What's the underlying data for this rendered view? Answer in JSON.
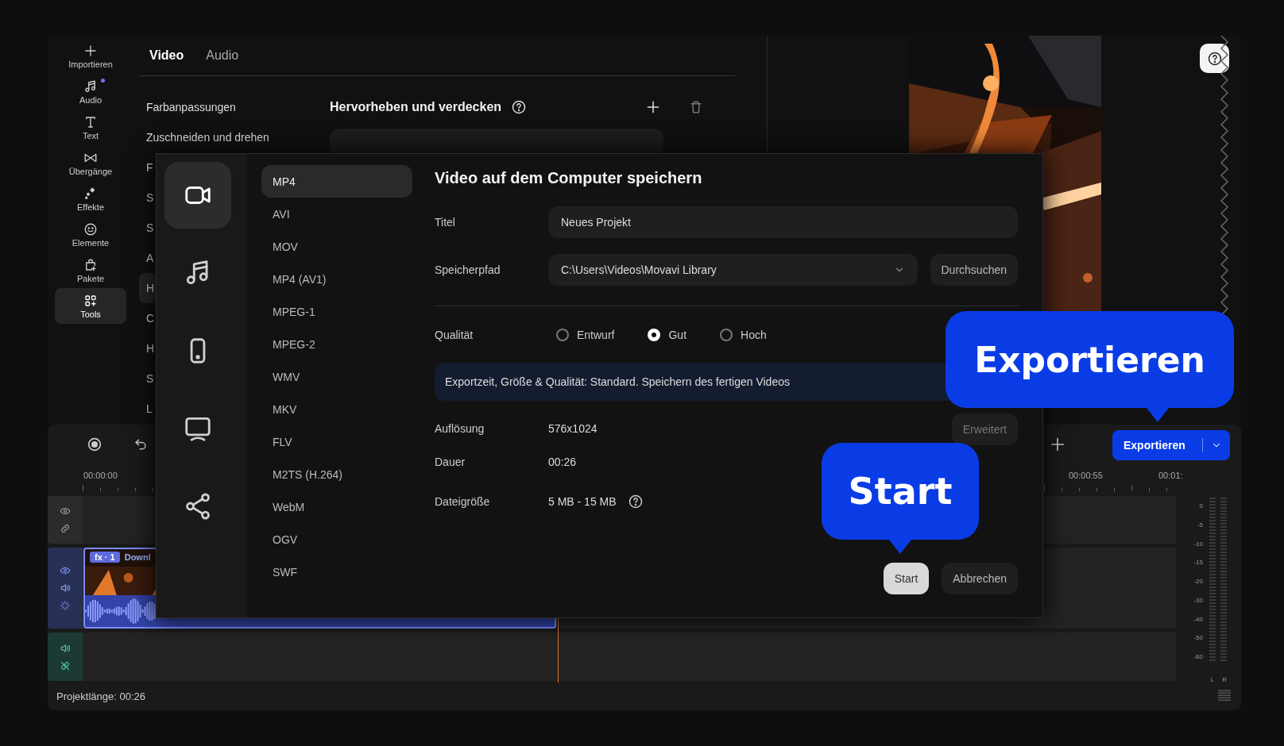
{
  "sidebar": {
    "items": [
      {
        "kind": "plus",
        "label": "Importieren",
        "selected": false,
        "badge": false
      },
      {
        "kind": "music",
        "label": "Audio",
        "selected": false,
        "badge": true
      },
      {
        "kind": "text",
        "label": "Text",
        "selected": false,
        "badge": false
      },
      {
        "kind": "transition",
        "label": "Übergänge",
        "selected": false,
        "badge": false
      },
      {
        "kind": "effects",
        "label": "Effekte",
        "selected": false,
        "badge": false
      },
      {
        "kind": "emoji",
        "label": "Elemente",
        "selected": false,
        "badge": false
      },
      {
        "kind": "package",
        "label": "Pakete",
        "selected": false,
        "badge": false
      },
      {
        "kind": "tools",
        "label": "Tools",
        "selected": true,
        "badge": false
      }
    ]
  },
  "panel": {
    "tabs": [
      {
        "label": "Video",
        "selected": true
      },
      {
        "label": "Audio",
        "selected": false
      }
    ],
    "items": [
      {
        "label": "Farbanpassungen",
        "selected": false
      },
      {
        "label": "Zuschneiden und drehen",
        "selected": false
      },
      {
        "label": "F",
        "selected": false
      },
      {
        "label": "S",
        "selected": false
      },
      {
        "label": "S",
        "selected": false
      },
      {
        "label": "A",
        "selected": false
      },
      {
        "label": "H",
        "selected": true
      },
      {
        "label": "C",
        "selected": false
      },
      {
        "label": "H",
        "selected": false
      },
      {
        "label": "S",
        "selected": false
      },
      {
        "label": "L",
        "selected": false
      }
    ],
    "section_title": "Hervorheben und verdecken"
  },
  "timeline": {
    "timecodes": [
      "00:00:00",
      "00:00:55",
      "00:01:"
    ],
    "export_button": "Exportieren",
    "tracks": [
      {
        "kind": "overlay"
      },
      {
        "kind": "video"
      },
      {
        "kind": "audio"
      }
    ],
    "clip": {
      "badge": "fx · 1",
      "name": "Downl"
    },
    "meter_scale": [
      "0",
      "-5",
      "-10",
      "-15",
      "-20",
      "-30",
      "-40",
      "-50",
      "-60"
    ],
    "meter_channels": [
      "L",
      "R"
    ],
    "project_length": "Projektlänge: 00:26"
  },
  "dialog": {
    "categories": [
      {
        "kind": "video",
        "selected": true
      },
      {
        "kind": "audio",
        "selected": false
      },
      {
        "kind": "mobile",
        "selected": false
      },
      {
        "kind": "tv",
        "selected": false
      },
      {
        "kind": "share",
        "selected": false
      }
    ],
    "formats": [
      {
        "label": "MP4",
        "selected": true
      },
      {
        "label": "AVI",
        "selected": false
      },
      {
        "label": "MOV",
        "selected": false
      },
      {
        "label": "MP4 (AV1)",
        "selected": false
      },
      {
        "label": "MPEG-1",
        "selected": false
      },
      {
        "label": "MPEG-2",
        "selected": false
      },
      {
        "label": "WMV",
        "selected": false
      },
      {
        "label": "MKV",
        "selected": false
      },
      {
        "label": "FLV",
        "selected": false
      },
      {
        "label": "M2TS (H.264)",
        "selected": false
      },
      {
        "label": "WebM",
        "selected": false
      },
      {
        "label": "OGV",
        "selected": false
      },
      {
        "label": "SWF",
        "selected": false
      }
    ],
    "title": "Video auf dem Computer speichern",
    "title_label": "Titel",
    "title_value": "Neues Projekt",
    "path_label": "Speicherpfad",
    "path_value": "C:\\Users\\Videos\\Movavi Library",
    "browse_button": "Durchsuchen",
    "quality_label": "Qualität",
    "quality_options": [
      {
        "label": "Entwurf",
        "selected": false
      },
      {
        "label": "Gut",
        "selected": true
      },
      {
        "label": "Hoch",
        "selected": false
      }
    ],
    "info": "Exportzeit, Größe & Qualität: Standard. Speichern des fertigen Videos",
    "details": [
      {
        "label": "Auflösung",
        "value": "576x1024",
        "help": false
      },
      {
        "label": "Dauer",
        "value": "00:26",
        "help": false
      },
      {
        "label": "Dateigröße",
        "value": "5 MB - 15 MB",
        "help": true
      }
    ],
    "advanced_button": "Erweitert",
    "buttons": [
      {
        "label": "Start",
        "kind": "primary"
      },
      {
        "label": "Abbrechen",
        "kind": "secondary"
      }
    ]
  },
  "callouts": [
    {
      "kind": "export",
      "text": "Exportieren"
    },
    {
      "kind": "start",
      "text": "Start"
    }
  ]
}
